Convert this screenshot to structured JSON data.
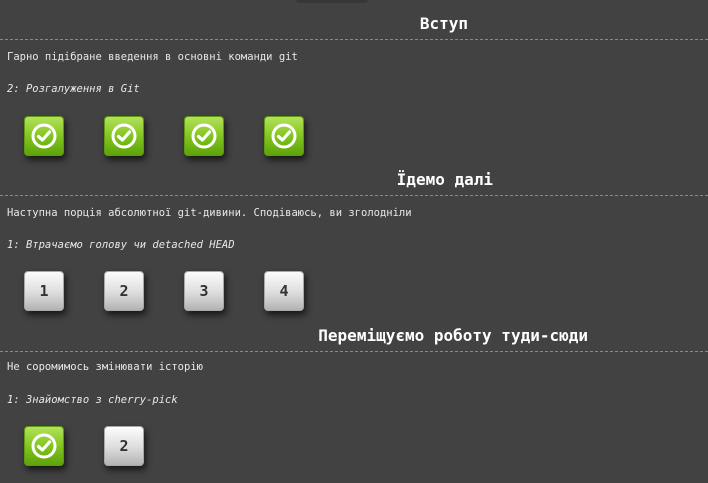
{
  "sections": [
    {
      "title": "Вступ",
      "description": "Гарно підібране введення в основні команди git",
      "subtitle": "2: Розгалуження в Git",
      "levels": [
        {
          "label": "",
          "status": "completed",
          "icon": "check-circle-icon"
        },
        {
          "label": "",
          "status": "completed",
          "icon": "check-circle-icon"
        },
        {
          "label": "",
          "status": "completed",
          "icon": "check-circle-icon"
        },
        {
          "label": "",
          "status": "completed",
          "icon": "check-circle-icon"
        }
      ]
    },
    {
      "title": "Їдемо далі",
      "description": "Наступна порція абсолютної git-дивини. Сподіваюсь, ви зголодніли",
      "subtitle": "1: Втрачаємо голову чи detached HEAD",
      "levels": [
        {
          "label": "1",
          "status": "not-completed"
        },
        {
          "label": "2",
          "status": "not-completed"
        },
        {
          "label": "3",
          "status": "not-completed"
        },
        {
          "label": "4",
          "status": "not-completed"
        }
      ]
    },
    {
      "title": "Переміщуємо роботу туди-сюди",
      "description": "Не соромимось змінювати історію",
      "subtitle": "1: Знайомство з cherry-pick",
      "levels": [
        {
          "label": "",
          "status": "completed",
          "icon": "check-circle-icon"
        },
        {
          "label": "2",
          "status": "not-completed"
        }
      ]
    }
  ],
  "colors": {
    "background": "#424242",
    "completed": "#7fc21b",
    "not_completed": "#dcdcdc"
  }
}
